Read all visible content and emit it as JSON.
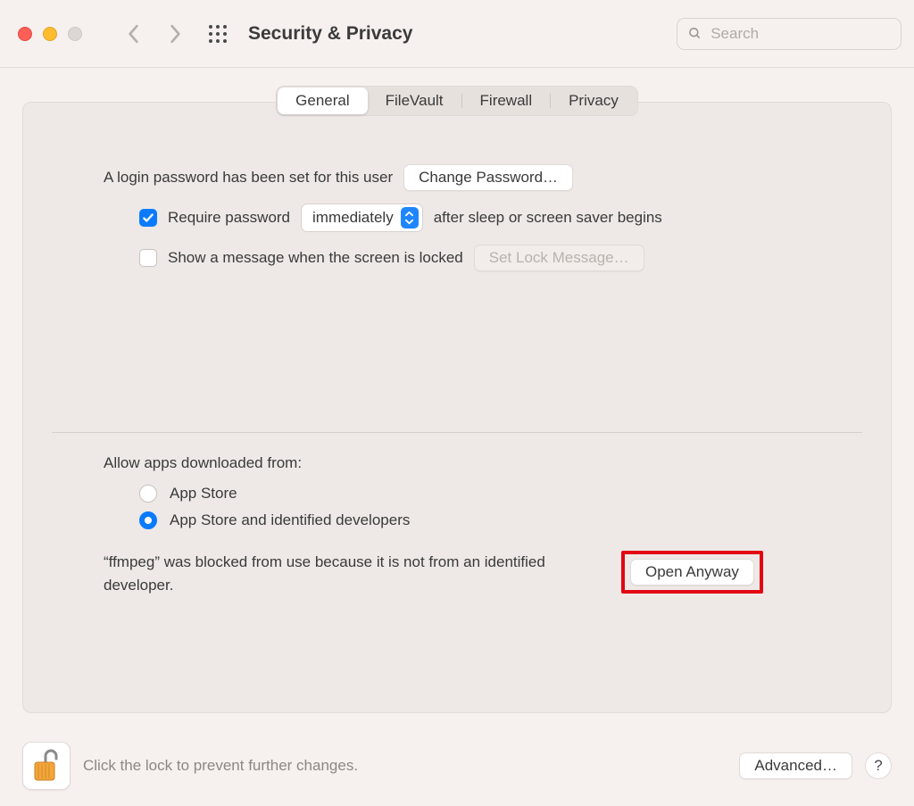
{
  "toolbar": {
    "title": "Security & Privacy",
    "search_placeholder": "Search"
  },
  "tabs": [
    "General",
    "FileVault",
    "Firewall",
    "Privacy"
  ],
  "general": {
    "login_password_set": "A login password has been set for this user",
    "change_password": "Change Password…",
    "require_password_label": "Require password",
    "delay_value": "immediately",
    "after_sleep": "after sleep or screen saver begins",
    "show_message": "Show a message when the screen is locked",
    "set_lock_message": "Set Lock Message…"
  },
  "allow": {
    "heading": "Allow apps downloaded from:",
    "option1": "App Store",
    "option2": "App Store and identified developers",
    "blocked_message": "“ffmpeg” was blocked from use because it is not from an identified developer.",
    "open_anyway": "Open Anyway"
  },
  "footer": {
    "lock_hint": "Click the lock to prevent further changes.",
    "advanced": "Advanced…",
    "help": "?"
  }
}
